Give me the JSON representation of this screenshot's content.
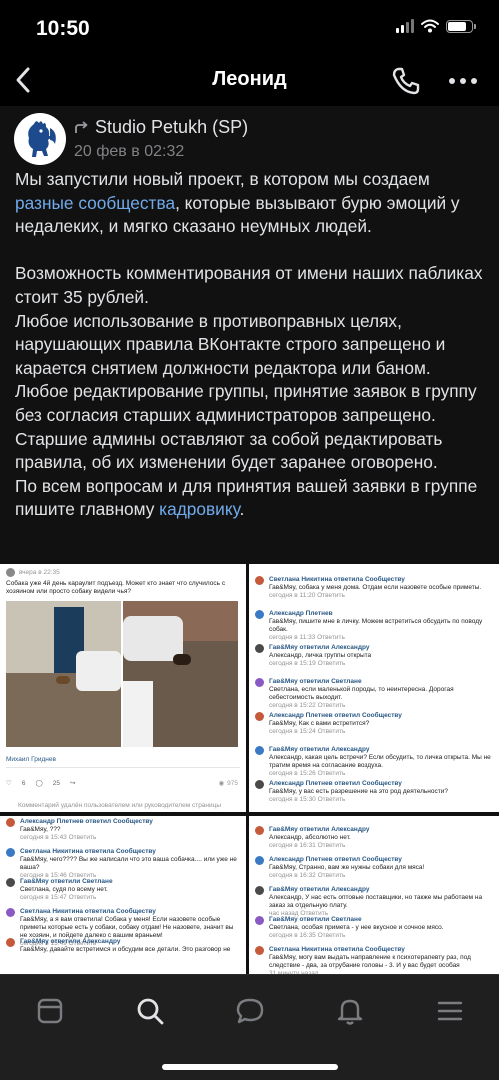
{
  "status": {
    "time": "10:50"
  },
  "nav": {
    "title": "Леонид"
  },
  "post": {
    "author": "Studio Petukh (SP)",
    "date": "20 фев в 02:32",
    "p1_a": "Мы запустили новый проект, в котором мы создаем ",
    "p1_link": "разные сообщества",
    "p1_b": ", которые вызывают бурю эмоций у недалеких, и мягко сказано неумных людей.",
    "p2": "Возможность комментирования от имени наших пабликах стоит 35 рублей.",
    "p3": "Любое использование в противоправных целях, нарушающих правила ВКонтакте строго запрещено и карается снятием должности редактора или баном.",
    "p4": "Любое редактирование группы, принятие заявок в группу без согласия старших администраторов запрещено.",
    "p5": "Старшие админы оставляют за собой редактировать правила, об их изменении будет заранее оговорено.",
    "p6_a": "По всем вопросам и для принятия вашей заявки в группе пишите главному ",
    "p6_link": "кадровику",
    "p6_b": "."
  },
  "shot1": {
    "time": "вчера в 22:35",
    "text": "Собака уже 4й день караулит подъезд. Может кто знает что случилось с хозяином или просто собаку видели чья?",
    "author": "Михаил Гриднев",
    "likes": "6",
    "comments": "25",
    "views": "975",
    "footer": "Комментарий удалён пользователем или руководителем страницы"
  },
  "shot2": {
    "rows": [
      {
        "name": "Светлана Никитина ответила Сообществу",
        "text": "Гав&Мяу, собака у меня дома. Отдам если назовете особые приметы.",
        "meta": "сегодня в 11:20  Ответить"
      },
      {
        "name": "Александр Плетнев",
        "text": "Гав&Мяу, пишите мне в личку. Можем встретиться обсудить по поводу собак.",
        "meta": "сегодня в 11:33  Ответить"
      },
      {
        "name": "Гав&Мяу ответили Александру",
        "text": "Александр, личка группы открыта",
        "meta": "сегодня в 15:19  Ответить"
      },
      {
        "name": "Гав&Мяу ответили Светлане",
        "text": "Светлана, если маленькой породы, то неинтересна. Дорогая себестоимость выходит.",
        "meta": "сегодня в 15:22  Ответить"
      },
      {
        "name": "Александр Плетнев ответил Сообществу",
        "text": "Гав&Мяу, Как с вами встретится?",
        "meta": "сегодня в 15:24  Ответить"
      },
      {
        "name": "Гав&Мяу ответили Александру",
        "text": "Александр, какая цель встречи? Если обсудить, то личка открыта. Мы не тратим время на согласание воздуха.",
        "meta": "сегодня в 15:26  Ответить"
      },
      {
        "name": "Александр Плетнев ответил Сообществу",
        "text": "Гав&Мяу, у вас есть разрешение на это род деятельности?",
        "meta": "сегодня в 15:30  Ответить"
      }
    ]
  },
  "shot3": {
    "rows": [
      {
        "name": "Александр Плетнев ответил Сообществу",
        "text": "Гав&Мяу, ???",
        "meta": "сегодня в 15:43  Ответить"
      },
      {
        "name": "Светлана Никитина ответила Сообществу",
        "text": "Гав&Мяу, чего???? Вы же написали что это ваша собачка.... или уже не ваша?",
        "meta": "сегодня в 15:46  Ответить"
      },
      {
        "name": "Гав&Мяу ответили Светлане",
        "text": "Светлана, судя по всему нет.",
        "meta": "сегодня в 15:47  Ответить"
      },
      {
        "name": "Светлана Никитина ответила Сообществу",
        "text": "Гав&Мяу, а я вам ответила! Собака у меня! Если назовете особые приметы которые есть у собаки, собаку отдам! Не назовете, значит вы не хозяин, и пойдете далеко с вашим враньем!",
        "meta": "сегодня в 15:49  Ответить"
      },
      {
        "name": "Гав&Мяу ответили Александру",
        "text": "Гав&Мяу, давайте встретимся и обсудим все детали. Это разговор не",
        "meta": ""
      }
    ]
  },
  "shot4": {
    "rows": [
      {
        "name": "Гав&Мяу ответили Александру",
        "text": "Александр, абсолютно нет.",
        "meta": "сегодня в 16:31  Ответить"
      },
      {
        "name": "Александр Плетнев ответил Сообществу",
        "text": "Гав&Мяу, Странно, вам же нужны собаки для мяса!",
        "meta": "сегодня в 16:32  Ответить"
      },
      {
        "name": "Гав&Мяу ответили Александру",
        "text": "Александр, У нас есть оптовые поставщики, но также мы работаем на заказ за отдельную плату.",
        "meta": "час назад  Ответить"
      },
      {
        "name": "Гав&Мяу ответили Светлане",
        "text": "Светлана, особая примета - у нее вкусное и сочное мясо.",
        "meta": "сегодня в 16:35  Ответить"
      },
      {
        "name": "Светлана Никитина ответила Сообществу",
        "text": "Гав&Мяу, могу вам выдать направление к психотерапевту раз, под следствие - два, за отрубание головы - 3. И у вас будет особая",
        "meta": "31 минуту назад"
      }
    ]
  },
  "tabs": [
    "Главная",
    "Поиск",
    "Сообщения",
    "Уведомления",
    "Меню"
  ],
  "colors": {
    "background": "#0a0a0a",
    "text": "#e1e3e6",
    "link": "#71aaeb",
    "secondary": "#808285",
    "tab_bar": "#1f1f20"
  }
}
